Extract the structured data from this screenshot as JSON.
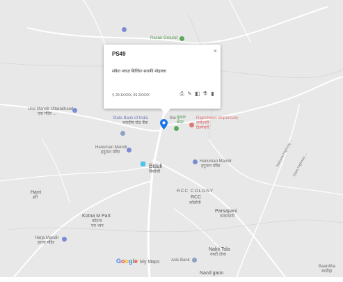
{
  "popup": {
    "title": "PS49",
    "close": "×",
    "description": "संकेत प्लाज़ बिल्डिंग सराफी मोहल्ला",
    "coordinates": "29.1XXXX, 81.2XXXX",
    "tools": [
      "print-icon",
      "edit-icon",
      "style-icon",
      "filter-icon",
      "delete-icon"
    ]
  },
  "labels": {
    "rasan_ground": "Rasan Ground",
    "una_mandir": "Una Mandir Uttarakhand",
    "una_mandir_hi": "एक मंदिर ...",
    "sbi": "State Bank of India",
    "sbi_hi": "भारतीय स्टेट बैंक",
    "karyalaya": "Bai",
    "kushal": "कुशल",
    "kushal2": "बाड़ा",
    "rajeshwari": "Rajeshwari dispensary",
    "rajeshwari_hi1": "राजेश्वरी",
    "rajeshwari_hi2": "डिस्पेंसरी",
    "hanuman_mandir1": "Hanuman Mandir",
    "hanuman_mandir1_hi": "हनुमान मंदिर",
    "hanuman_mandir2": "Hanuman Mandir",
    "hanuman_mandir2_hi": "हनुमान मंदिर",
    "bisuli": "Bisuli",
    "bisuli_hi": "बिसौली",
    "rcc_colony": "RCC COLONY",
    "rcc": "RCC",
    "rcc_hi": "कॉलोनी",
    "harri": "Harri",
    "harri_hi": "हरी",
    "kotna": "Kotna M Part",
    "kotna_hi1": "कोतना",
    "kotna_hi2": "एम भाग",
    "parsapani": "Parsapani",
    "parsapani_hi": "पारसपानी",
    "haripur": "Harja Mandir",
    "haripur_hi": "हरजा मंदिर",
    "nakti": "Nakti Tola",
    "nakti_hi": "नक्टी टोला",
    "axis_bank": "Axis Bank",
    "nand_gaon": "Nand gaon",
    "baardiha": "Baardiha",
    "baardiha_hi": "बरडीहा",
    "road1": "National Highway ...",
    "road2": "State Highway ..."
  },
  "branding": {
    "google1": "G",
    "google2": "o",
    "google3": "o",
    "google4": "g",
    "google5": "l",
    "google6": "e",
    "mymaps": "My Maps"
  },
  "colors": {
    "map_bg": "#e8e8e8",
    "road": "#ffffff",
    "pin": "#1a73e8"
  }
}
